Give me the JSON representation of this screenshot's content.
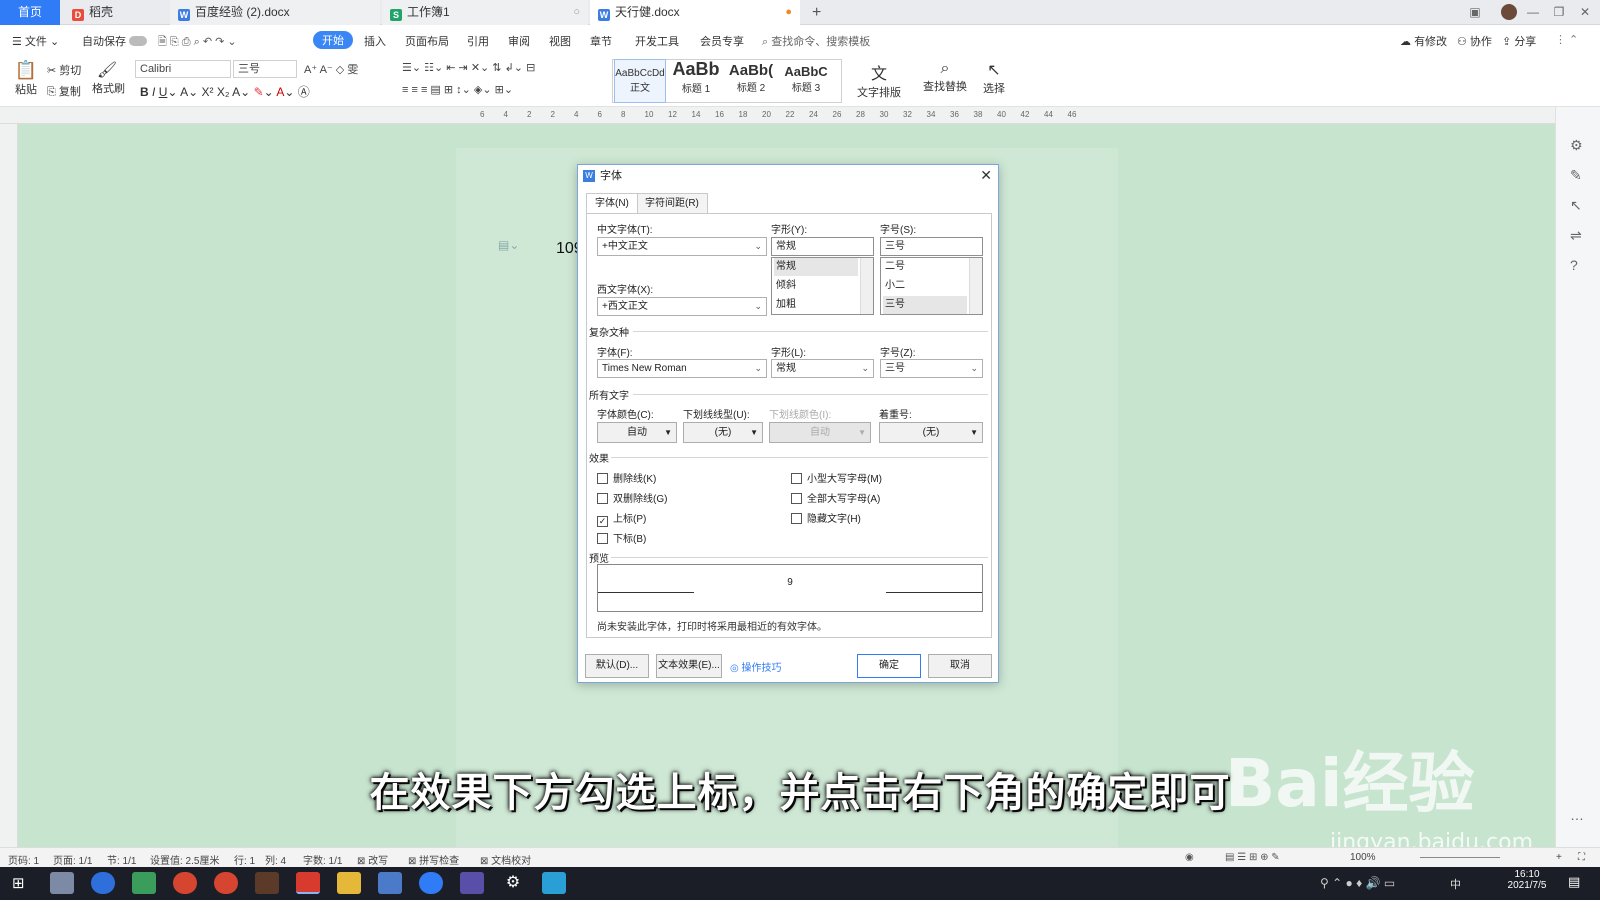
{
  "tabs": {
    "home": "首页",
    "doc1": "稻壳",
    "doc2": "百度经验 (2).docx",
    "doc3": "工作簿1",
    "doc4": "天行健.docx",
    "new": "+"
  },
  "menu": {
    "file": "文件",
    "autosave": "自动保存",
    "items": [
      "开始",
      "插入",
      "页面布局",
      "引用",
      "审阅",
      "视图",
      "章节",
      "开发工具",
      "会员专享"
    ],
    "search": "查找命令、搜索模板",
    "right": [
      "有修改",
      "协作",
      "分享"
    ]
  },
  "ribbon": {
    "paste": "粘贴",
    "cut": "剪切",
    "copy": "复制",
    "format_painter": "格式刷",
    "font_name": "Calibri",
    "font_size": "三号",
    "styles": [
      {
        "preview": "AaBbCcDd",
        "label": "正文"
      },
      {
        "preview": "AaBb",
        "label": "标题 1"
      },
      {
        "preview": "AaBb(",
        "label": "标题 2"
      },
      {
        "preview": "AaBbC",
        "label": "标题 3"
      }
    ],
    "text_layout": "文字排版",
    "find_replace": "查找替换",
    "select": "选择"
  },
  "ruler_numbers": [
    "6",
    "4",
    "2",
    "2",
    "4",
    "6",
    "8",
    "10",
    "12",
    "14",
    "16",
    "18",
    "20",
    "22",
    "24",
    "26",
    "28",
    "30",
    "32",
    "34",
    "36",
    "38",
    "40",
    "42",
    "44",
    "46"
  ],
  "document": {
    "visible_text": "109"
  },
  "dialog": {
    "title": "字体",
    "tabs": [
      "字体(N)",
      "字符间距(R)"
    ],
    "cn_font_label": "中文字体(T):",
    "cn_font_value": "+中文正文",
    "style_label": "字形(Y):",
    "style_value": "常规",
    "style_options": [
      "常规",
      "倾斜",
      "加粗"
    ],
    "size_label": "字号(S):",
    "size_value": "三号",
    "size_options": [
      "二号",
      "小二",
      "三号"
    ],
    "west_font_label": "西文字体(X):",
    "west_font_value": "+西文正文",
    "complex_section": "复杂文种",
    "complex_font_label": "字体(F):",
    "complex_font_value": "Times New Roman",
    "complex_style_label": "字形(L):",
    "complex_style_value": "常规",
    "complex_size_label": "字号(Z):",
    "complex_size_value": "三号",
    "all_text_section": "所有文字",
    "color_label": "字体颜色(C):",
    "color_value": "自动",
    "underline_label": "下划线线型(U):",
    "underline_value": "(无)",
    "underline_color_label": "下划线颜色(I):",
    "underline_color_value": "自动",
    "emphasis_label": "着重号:",
    "emphasis_value": "(无)",
    "effects_section": "效果",
    "effects": [
      {
        "label": "删除线(K)",
        "checked": false
      },
      {
        "label": "双删除线(G)",
        "checked": false
      },
      {
        "label": "上标(P)",
        "checked": true
      },
      {
        "label": "下标(B)",
        "checked": false
      },
      {
        "label": "小型大写字母(M)",
        "checked": false
      },
      {
        "label": "全部大写字母(A)",
        "checked": false
      },
      {
        "label": "隐藏文字(H)",
        "checked": false
      }
    ],
    "preview_section": "预览",
    "preview_text": "9",
    "preview_note": "尚未安装此字体，打印时将采用最相近的有效字体。",
    "default_btn": "默认(D)...",
    "text_effect_btn": "文本效果(E)...",
    "tips_link": "操作技巧",
    "ok_btn": "确定",
    "cancel_btn": "取消"
  },
  "status": {
    "page_num": "页码: 1",
    "pages": "页面: 1/1",
    "section": "节: 1/1",
    "setting": "设置值: 2.5厘米",
    "row": "行: 1",
    "col": "列: 4",
    "words": "字数: 1/1",
    "revise": "改写",
    "spell": "拼写检查",
    "proof": "文档校对",
    "zoom": "100%"
  },
  "taskbar": {
    "time": "16:10",
    "date": "2021/7/5",
    "ime": "中"
  },
  "caption": "在效果下方勾选上标，并点击右下角的确定即可",
  "watermark": {
    "brand": "Bai经验",
    "url": "jingyan.baidu.com"
  }
}
